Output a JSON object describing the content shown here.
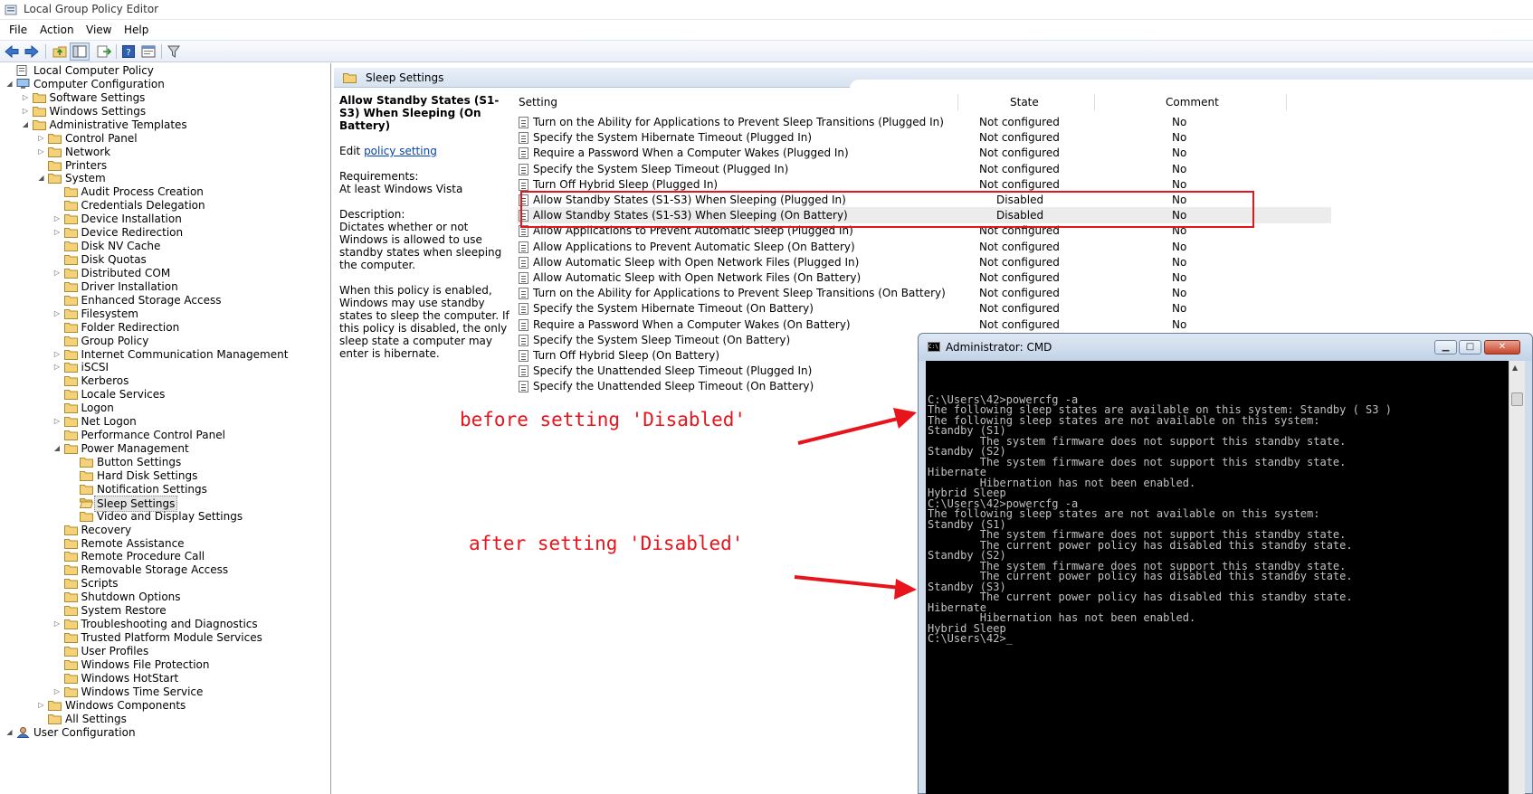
{
  "window": {
    "title": "Local Group Policy Editor"
  },
  "menu": [
    "File",
    "Action",
    "View",
    "Help"
  ],
  "toolbar": {
    "icons": [
      "back-icon",
      "forward-icon",
      "up-folder-icon",
      "show-hide-tree-icon",
      "export-list-icon",
      "help-icon",
      "properties-icon",
      "filter-icon"
    ]
  },
  "tree": [
    {
      "label": "Local Computer Policy",
      "level": 0,
      "expander": "",
      "icon": "policy"
    },
    {
      "label": "Computer Configuration",
      "level": 0,
      "expander": "open",
      "icon": "computer"
    },
    {
      "label": "Software Settings",
      "level": 1,
      "expander": "closed",
      "icon": "folder"
    },
    {
      "label": "Windows Settings",
      "level": 1,
      "expander": "closed",
      "icon": "folder"
    },
    {
      "label": "Administrative Templates",
      "level": 1,
      "expander": "open",
      "icon": "folder"
    },
    {
      "label": "Control Panel",
      "level": 2,
      "expander": "closed",
      "icon": "folder"
    },
    {
      "label": "Network",
      "level": 2,
      "expander": "closed",
      "icon": "folder"
    },
    {
      "label": "Printers",
      "level": 2,
      "expander": "",
      "icon": "folder"
    },
    {
      "label": "System",
      "level": 2,
      "expander": "open",
      "icon": "folder"
    },
    {
      "label": "Audit Process Creation",
      "level": 3,
      "expander": "",
      "icon": "folder"
    },
    {
      "label": "Credentials Delegation",
      "level": 3,
      "expander": "",
      "icon": "folder"
    },
    {
      "label": "Device Installation",
      "level": 3,
      "expander": "closed",
      "icon": "folder"
    },
    {
      "label": "Device Redirection",
      "level": 3,
      "expander": "closed",
      "icon": "folder"
    },
    {
      "label": "Disk NV Cache",
      "level": 3,
      "expander": "",
      "icon": "folder"
    },
    {
      "label": "Disk Quotas",
      "level": 3,
      "expander": "",
      "icon": "folder"
    },
    {
      "label": "Distributed COM",
      "level": 3,
      "expander": "closed",
      "icon": "folder"
    },
    {
      "label": "Driver Installation",
      "level": 3,
      "expander": "",
      "icon": "folder"
    },
    {
      "label": "Enhanced Storage Access",
      "level": 3,
      "expander": "",
      "icon": "folder"
    },
    {
      "label": "Filesystem",
      "level": 3,
      "expander": "closed",
      "icon": "folder"
    },
    {
      "label": "Folder Redirection",
      "level": 3,
      "expander": "",
      "icon": "folder"
    },
    {
      "label": "Group Policy",
      "level": 3,
      "expander": "",
      "icon": "folder"
    },
    {
      "label": "Internet Communication Management",
      "level": 3,
      "expander": "closed",
      "icon": "folder"
    },
    {
      "label": "iSCSI",
      "level": 3,
      "expander": "closed",
      "icon": "folder"
    },
    {
      "label": "Kerberos",
      "level": 3,
      "expander": "",
      "icon": "folder"
    },
    {
      "label": "Locale Services",
      "level": 3,
      "expander": "",
      "icon": "folder"
    },
    {
      "label": "Logon",
      "level": 3,
      "expander": "",
      "icon": "folder"
    },
    {
      "label": "Net Logon",
      "level": 3,
      "expander": "closed",
      "icon": "folder"
    },
    {
      "label": "Performance Control Panel",
      "level": 3,
      "expander": "",
      "icon": "folder"
    },
    {
      "label": "Power Management",
      "level": 3,
      "expander": "open",
      "icon": "folder"
    },
    {
      "label": "Button Settings",
      "level": 4,
      "expander": "",
      "icon": "folder"
    },
    {
      "label": "Hard Disk Settings",
      "level": 4,
      "expander": "",
      "icon": "folder"
    },
    {
      "label": "Notification Settings",
      "level": 4,
      "expander": "",
      "icon": "folder"
    },
    {
      "label": "Sleep Settings",
      "level": 4,
      "expander": "",
      "icon": "folder-open",
      "selected": true
    },
    {
      "label": "Video and Display Settings",
      "level": 4,
      "expander": "",
      "icon": "folder"
    },
    {
      "label": "Recovery",
      "level": 3,
      "expander": "",
      "icon": "folder"
    },
    {
      "label": "Remote Assistance",
      "level": 3,
      "expander": "",
      "icon": "folder"
    },
    {
      "label": "Remote Procedure Call",
      "level": 3,
      "expander": "",
      "icon": "folder"
    },
    {
      "label": "Removable Storage Access",
      "level": 3,
      "expander": "",
      "icon": "folder"
    },
    {
      "label": "Scripts",
      "level": 3,
      "expander": "",
      "icon": "folder"
    },
    {
      "label": "Shutdown Options",
      "level": 3,
      "expander": "",
      "icon": "folder"
    },
    {
      "label": "System Restore",
      "level": 3,
      "expander": "",
      "icon": "folder"
    },
    {
      "label": "Troubleshooting and Diagnostics",
      "level": 3,
      "expander": "closed",
      "icon": "folder"
    },
    {
      "label": "Trusted Platform Module Services",
      "level": 3,
      "expander": "",
      "icon": "folder"
    },
    {
      "label": "User Profiles",
      "level": 3,
      "expander": "",
      "icon": "folder"
    },
    {
      "label": "Windows File Protection",
      "level": 3,
      "expander": "",
      "icon": "folder"
    },
    {
      "label": "Windows HotStart",
      "level": 3,
      "expander": "",
      "icon": "folder"
    },
    {
      "label": "Windows Time Service",
      "level": 3,
      "expander": "closed",
      "icon": "folder"
    },
    {
      "label": "Windows Components",
      "level": 2,
      "expander": "closed",
      "icon": "folder"
    },
    {
      "label": "All Settings",
      "level": 2,
      "expander": "",
      "icon": "folder"
    },
    {
      "label": "User Configuration",
      "level": 0,
      "expander": "open",
      "icon": "user"
    }
  ],
  "pane": {
    "header": "Sleep Settings",
    "description": {
      "title": "Allow Standby States (S1-S3) When Sleeping (On Battery)",
      "edit_prefix": "Edit ",
      "edit_link": "policy setting ",
      "requirements_label": "Requirements:",
      "requirements_value": "At least Windows Vista",
      "description_label": "Description:",
      "description_text": "Dictates whether or not Windows is allowed to use standby states when sleeping the computer.",
      "enabled_text": "When this policy is enabled, Windows may use standby states to sleep the computer. If this policy is disabled, the only sleep state a computer may enter is hibernate."
    },
    "columns": {
      "setting": "Setting",
      "state": "State",
      "comment": "Comment"
    },
    "rows": [
      {
        "setting": "Turn on the Ability for Applications to Prevent Sleep Transitions (Plugged In)",
        "state": "Not configured",
        "comment": "No"
      },
      {
        "setting": "Specify the System Hibernate Timeout (Plugged In)",
        "state": "Not configured",
        "comment": "No"
      },
      {
        "setting": "Require a Password When a Computer Wakes (Plugged In)",
        "state": "Not configured",
        "comment": "No"
      },
      {
        "setting": "Specify the System Sleep Timeout (Plugged In)",
        "state": "Not configured",
        "comment": "No"
      },
      {
        "setting": "Turn Off Hybrid Sleep (Plugged In)",
        "state": "Not configured",
        "comment": "No"
      },
      {
        "setting": "Allow Standby States (S1-S3) When Sleeping (Plugged In)",
        "state": "Disabled",
        "comment": "No"
      },
      {
        "setting": "Allow Standby States (S1-S3) When Sleeping (On Battery)",
        "state": "Disabled",
        "comment": "No",
        "selected": true
      },
      {
        "setting": "Allow Applications to Prevent Automatic Sleep (Plugged In)",
        "state": "Not configured",
        "comment": "No"
      },
      {
        "setting": "Allow Applications to Prevent Automatic Sleep (On Battery)",
        "state": "Not configured",
        "comment": "No"
      },
      {
        "setting": "Allow Automatic Sleep with Open Network Files (Plugged In)",
        "state": "Not configured",
        "comment": "No"
      },
      {
        "setting": "Allow Automatic Sleep with Open Network Files (On Battery)",
        "state": "Not configured",
        "comment": "No"
      },
      {
        "setting": "Turn on the Ability for Applications to Prevent Sleep Transitions (On Battery)",
        "state": "Not configured",
        "comment": "No"
      },
      {
        "setting": "Specify the System Hibernate Timeout (On Battery)",
        "state": "Not configured",
        "comment": "No"
      },
      {
        "setting": "Require a Password When a Computer Wakes (On Battery)",
        "state": "Not configured",
        "comment": "No"
      },
      {
        "setting": "Specify the System Sleep Timeout (On Battery)",
        "state": "",
        "comment": ""
      },
      {
        "setting": "Turn Off Hybrid Sleep (On Battery)",
        "state": "",
        "comment": ""
      },
      {
        "setting": "Specify the Unattended Sleep Timeout (Plugged In)",
        "state": "",
        "comment": ""
      },
      {
        "setting": "Specify the Unattended Sleep Timeout (On Battery)",
        "state": "",
        "comment": ""
      }
    ]
  },
  "cmd": {
    "title": "Administrator: CMD",
    "icon_text": "C:\\",
    "minimize": "▁",
    "maximize": "□",
    "close": "✕",
    "lines": [
      "",
      "",
      "",
      "C:\\Users\\42>powercfg -a",
      "The following sleep states are available on this system: Standby ( S3 )",
      "The following sleep states are not available on this system:",
      "Standby (S1)",
      "        The system firmware does not support this standby state.",
      "Standby (S2)",
      "        The system firmware does not support this standby state.",
      "Hibernate",
      "        Hibernation has not been enabled.",
      "Hybrid Sleep",
      "C:\\Users\\42>powercfg -a",
      "The following sleep states are not available on this system:",
      "Standby (S1)",
      "        The system firmware does not support this standby state.",
      "        The current power policy has disabled this standby state.",
      "Standby (S2)",
      "        The system firmware does not support this standby state.",
      "        The current power policy has disabled this standby state.",
      "Standby (S3)",
      "        The current power policy has disabled this standby state.",
      "Hibernate",
      "        Hibernation has not been enabled.",
      "Hybrid Sleep",
      "C:\\Users\\42>_"
    ]
  },
  "annotations": {
    "before": "before setting 'Disabled'",
    "after": "after setting 'Disabled'"
  },
  "colors": {
    "highlight": "#e8141c",
    "link": "#0645ad",
    "folder": "#f3d27a"
  }
}
